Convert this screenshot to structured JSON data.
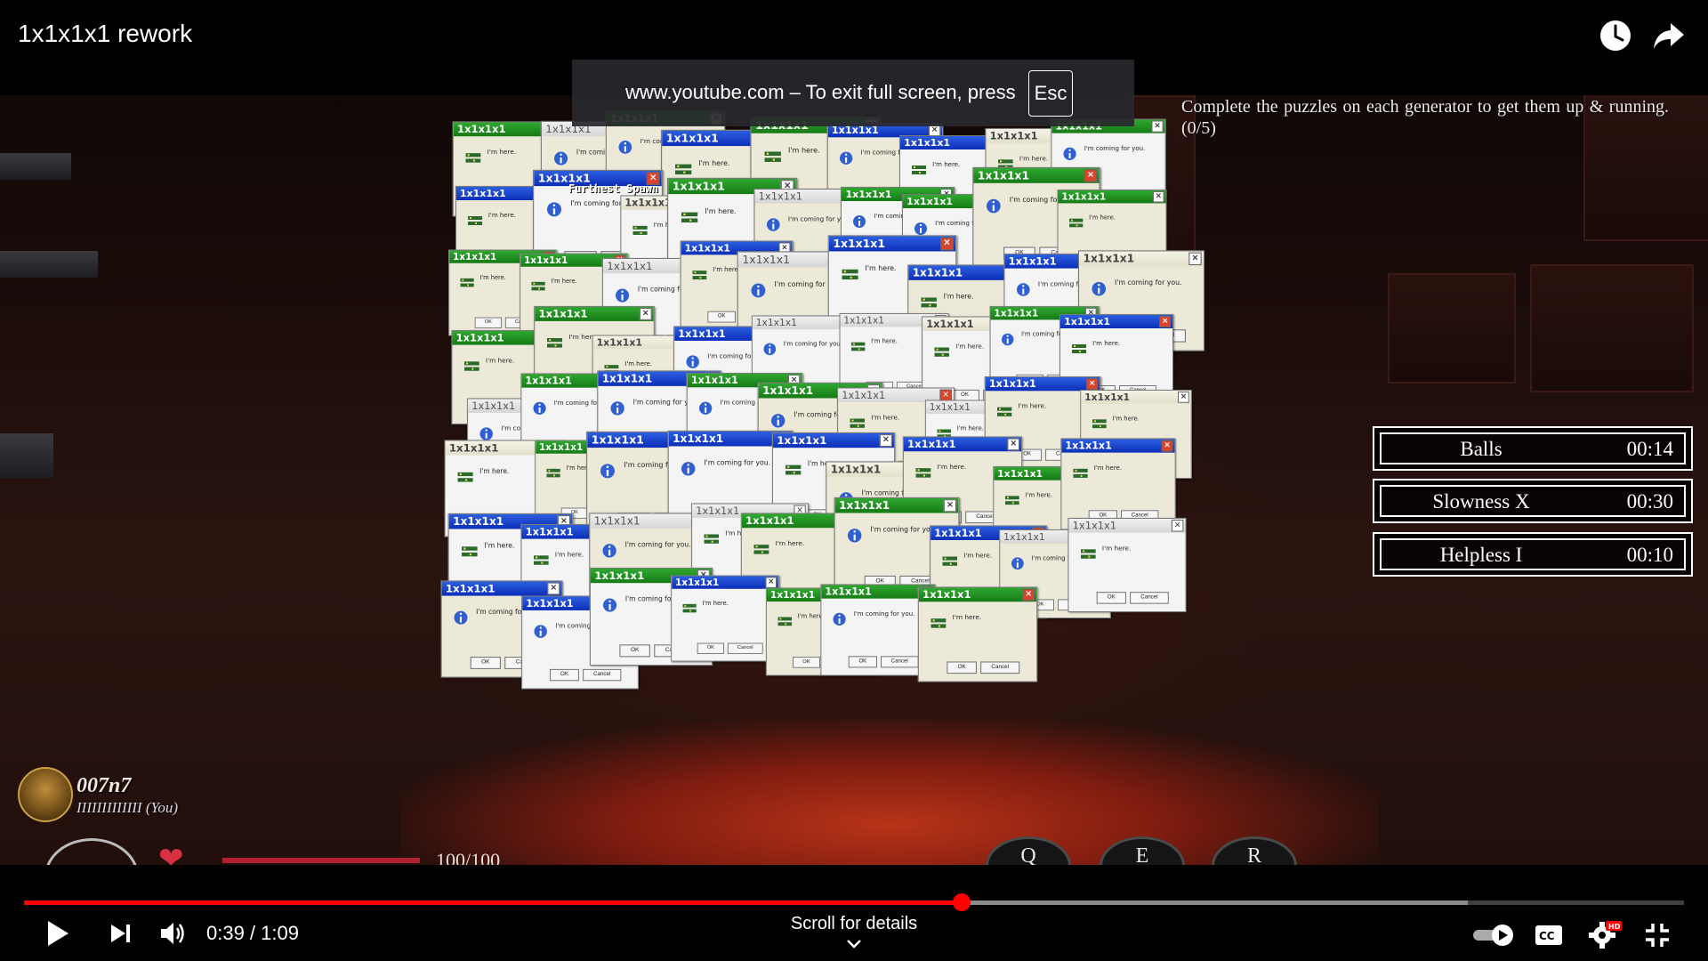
{
  "video": {
    "title": "1x1x1x1 rework",
    "current_time": "0:39",
    "duration": "1:09",
    "time_display": "0:39 / 1:09",
    "progress_fraction": 0.565,
    "buffer_fraction": 0.87,
    "scroll_hint": "Scroll for details"
  },
  "fullscreen_banner": {
    "text": "www.youtube.com – To exit full screen, press",
    "key": "Esc"
  },
  "game": {
    "quest": "Complete the puzzles on each generator to get them up & running. (0/5)",
    "spawn_label": "Furthest Spawn",
    "status_effects": [
      {
        "name": "Balls",
        "time": "00:14"
      },
      {
        "name": "Slowness X",
        "time": "00:30"
      },
      {
        "name": "Helpless I",
        "time": "00:10"
      }
    ],
    "player": {
      "name": "007n7",
      "tag": "IIIIIIIIIIIII (You)"
    },
    "health": {
      "text": "100/100",
      "fraction": 1.0
    },
    "hotkeys": [
      "Q",
      "E",
      "R"
    ],
    "popup_windows": {
      "title": "1x1x1x1",
      "messages": [
        "I'm here.",
        "I'm coming for you."
      ],
      "ok_label": "OK",
      "cancel_label": "Cancel"
    }
  },
  "colors": {
    "progress_played": "#ff0000",
    "xp_green_title": "#1a8a1a",
    "xp_blue_title": "#1a40d0",
    "status_border": "#ffffff"
  },
  "icons": {
    "top_right": [
      "clock-icon",
      "share-icon"
    ],
    "controls_left": [
      "play-icon",
      "next-icon",
      "volume-icon"
    ],
    "controls_right": [
      "autoplay-toggle-icon",
      "captions-icon",
      "settings-icon",
      "exit-fullscreen-icon"
    ]
  }
}
